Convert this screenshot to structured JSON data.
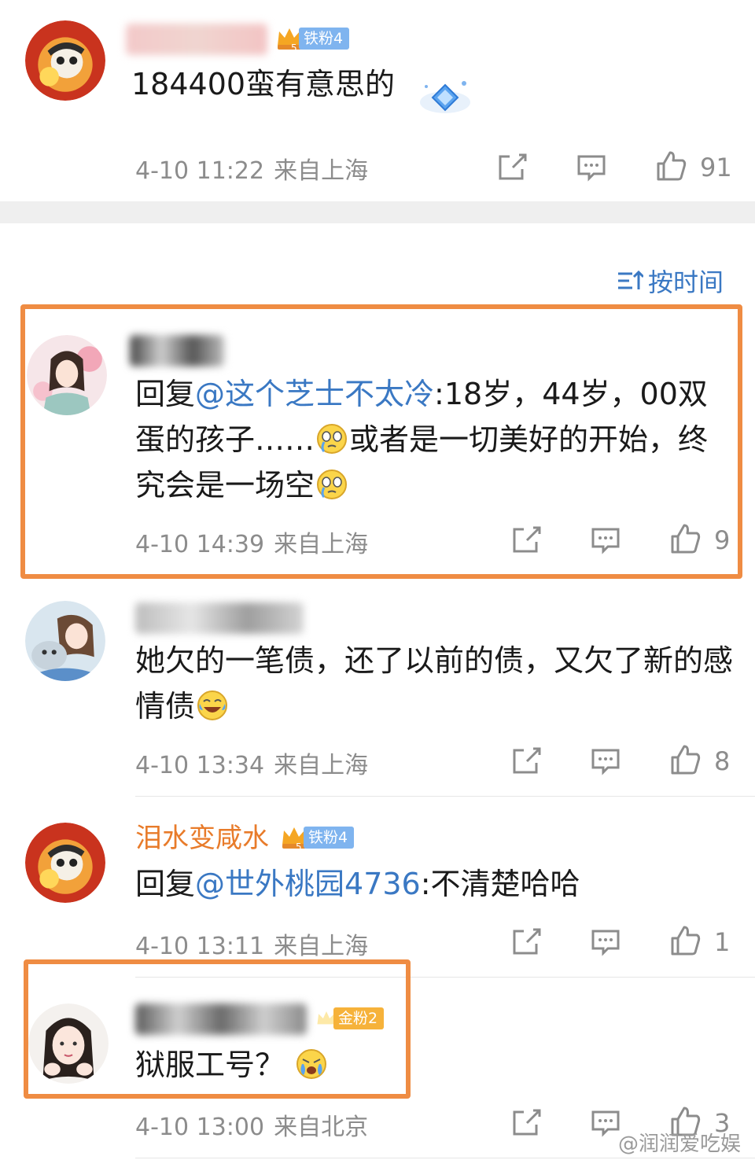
{
  "sort_label": "按时间",
  "watermark": "@润润爱吃娱",
  "comments": [
    {
      "username": "",
      "badge": "铁粉4",
      "text": "184400蛮有意思的",
      "date": "4-10 11:22",
      "location": "来自上海",
      "likes": "91"
    },
    {
      "username": "",
      "reply_prefix": "回复",
      "mention": "@这个芝士不太冷",
      "text": ":18岁，44岁，00双蛋的孩子……",
      "text2": "或者是一切美好的开始，终究会是一场空",
      "date": "4-10 14:39",
      "location": "来自上海",
      "likes": "9"
    },
    {
      "username": "",
      "text": "她欠的一笔债，还了以前的债，又欠了新的感情债",
      "date": "4-10 13:34",
      "location": "来自上海",
      "likes": "8"
    },
    {
      "username": "泪水变咸水",
      "badge": "铁粉4",
      "reply_prefix": "回复",
      "mention": "@世外桃园4736",
      "text": ":不清楚哈哈",
      "date": "4-10 13:11",
      "location": "来自上海",
      "likes": "1"
    },
    {
      "username": "",
      "badge": "金粉2",
      "text": "狱服工号？",
      "date": "4-10 13:00",
      "location": "来自北京",
      "likes": "3"
    }
  ],
  "colors": {
    "mention": "#3a78c3",
    "username": "#e87b2a",
    "highlight": "#ef8c43",
    "meta": "#8c8c8c"
  }
}
